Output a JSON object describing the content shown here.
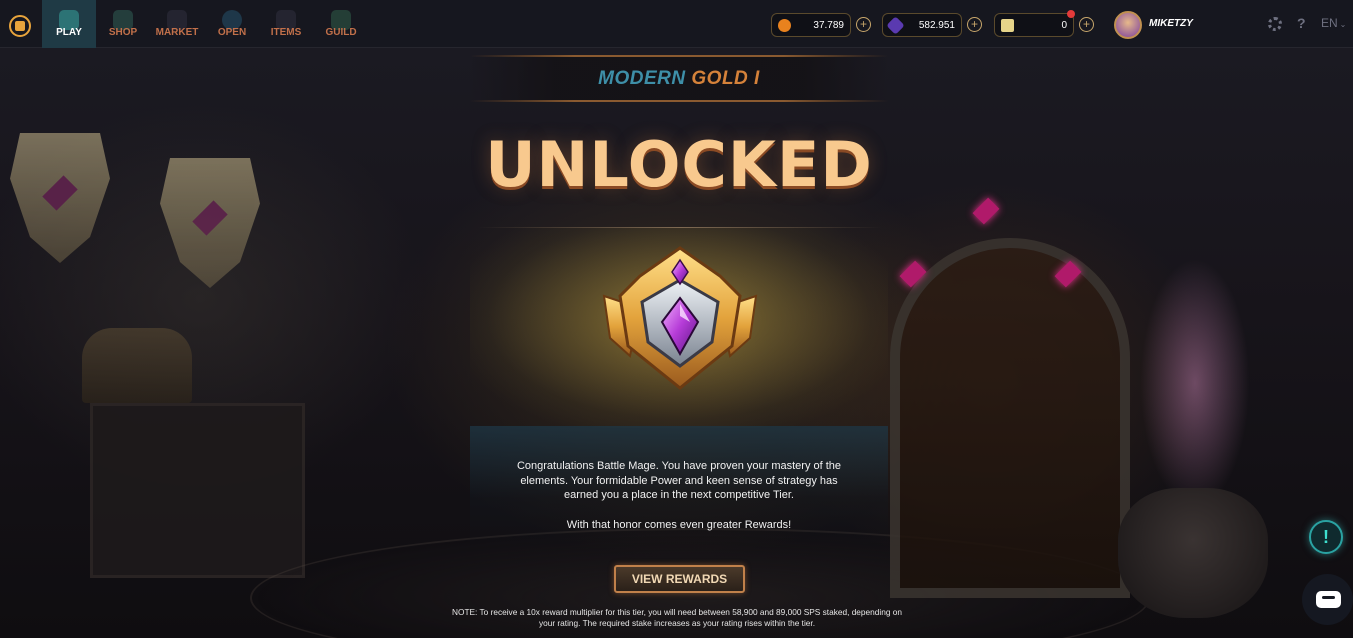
{
  "nav": {
    "items": [
      {
        "label": "PLAY",
        "active": true,
        "icon": "sword-banner-icon"
      },
      {
        "label": "SHOP",
        "active": false,
        "icon": "shop-icon"
      },
      {
        "label": "MARKET",
        "active": false,
        "icon": "market-icon"
      },
      {
        "label": "OPEN",
        "active": false,
        "icon": "open-pack-icon"
      },
      {
        "label": "ITEMS",
        "active": false,
        "icon": "items-icon"
      },
      {
        "label": "GUILD",
        "active": false,
        "icon": "guild-icon"
      }
    ]
  },
  "wallet": {
    "credits": "37.789",
    "dec": "582.951",
    "vouchers": "0"
  },
  "user": {
    "name": "MIKETZY"
  },
  "header": {
    "help": "?",
    "language": "EN"
  },
  "tier": {
    "league": "MODERN",
    "rank": "GOLD I"
  },
  "main": {
    "heading": "UNLOCKED",
    "congrats": "Congratulations Battle Mage. You have proven your mastery of the elements. Your formidable Power and keen sense of strategy has earned you a place in the next competitive Tier.",
    "honor": "With that honor comes even greater Rewards!",
    "button_label": "VIEW REWARDS",
    "note": "NOTE: To receive a 10x reward multiplier for this tier, you will need between 58,900 and 89,000 SPS staked, depending on your rating. The required stake increases as your rating rises within the tier."
  },
  "colors": {
    "accent_orange": "#d5823a",
    "accent_teal": "#3e8fa8",
    "unlocked_text": "#f8c98e",
    "nav_text": "#c1704a",
    "active_nav_bg": "#1f3a45"
  },
  "widgets": {
    "alert": "!"
  }
}
